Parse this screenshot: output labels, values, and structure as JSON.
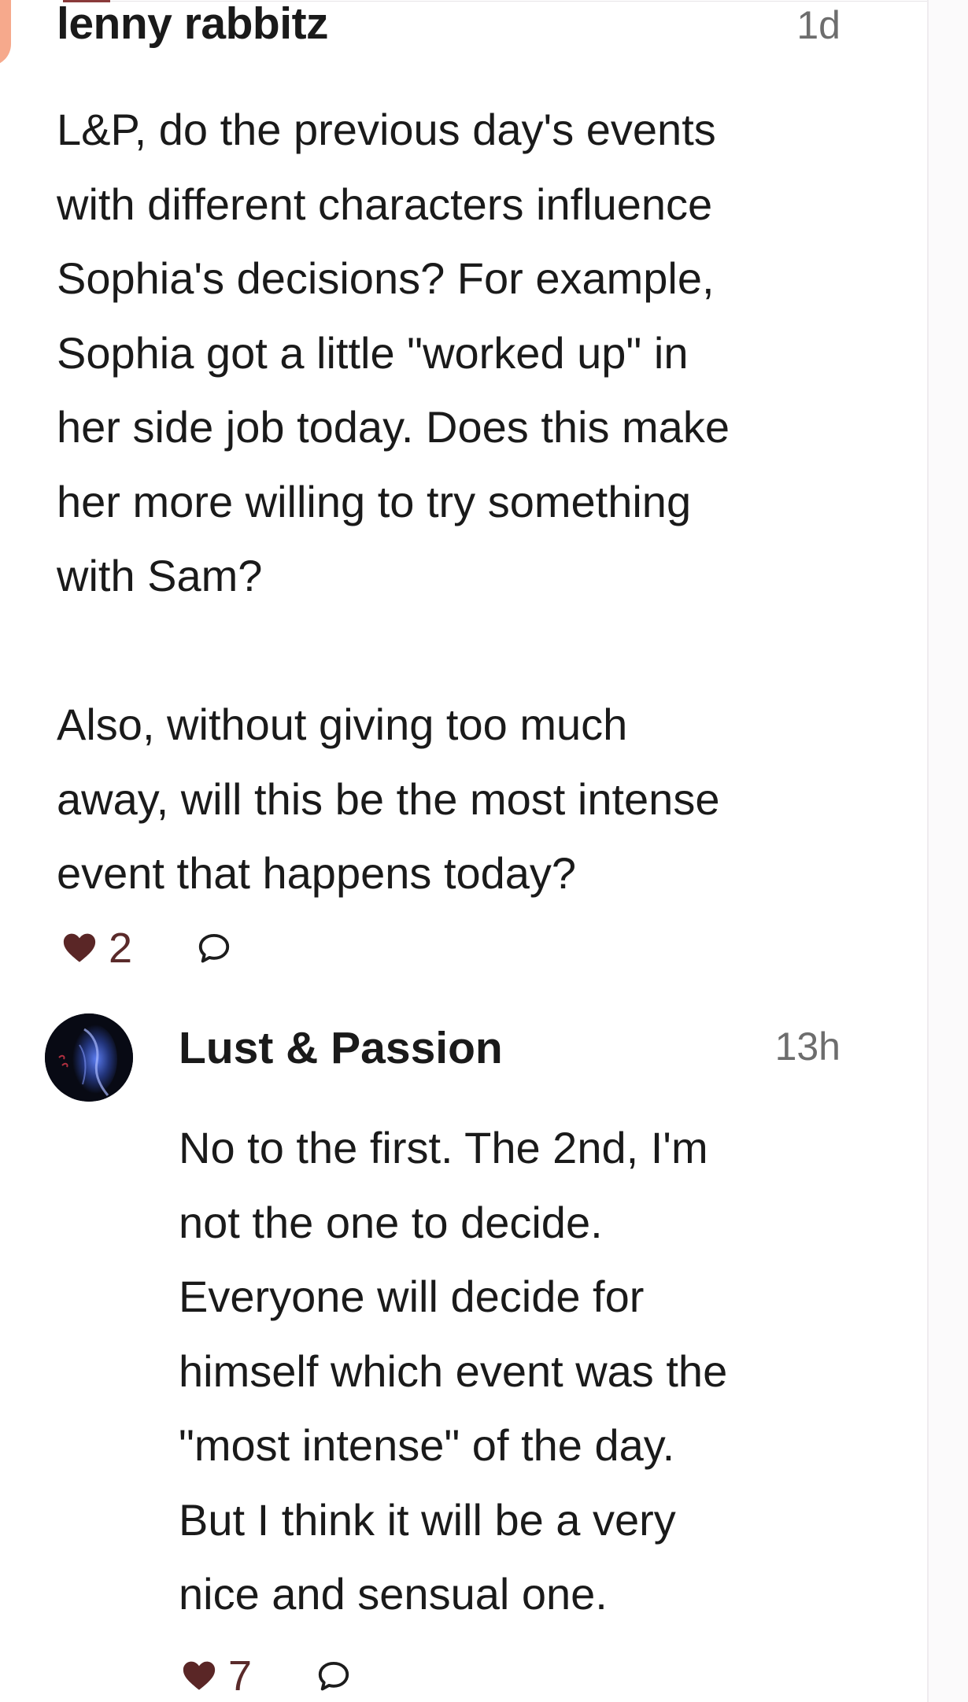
{
  "comment": {
    "author": "lenny rabbitz",
    "time": "1d",
    "paragraphs": [
      "L&P, do the previous day's events\nwith different characters influence\nSophia's decisions? For example,\nSophia got a little \"worked up\" in\nher side job today. Does this make\nher more willing to try something\nwith Sam?",
      "Also, without giving too much\naway, will this be the most intense\nevent that happens today?"
    ],
    "likes": "2",
    "avatar_icon": "user-avatar"
  },
  "reply": {
    "author": "Lust & Passion",
    "time": "13h",
    "paragraphs": [
      "No to the first. The 2nd, I'm\nnot the one to decide.\nEveryone will decide for\nhimself which event was the\n\"most intense\" of the day.\nBut I think it will be a very\nnice and sensual one."
    ],
    "likes": "7",
    "avatar_icon": "author-avatar"
  },
  "icons": {
    "like": "heart-icon",
    "reply": "speech-bubble-icon"
  },
  "colors": {
    "heart": "#5a2626",
    "avatar_partial": "#f6a98c",
    "meta_text": "#6d6d6d"
  }
}
